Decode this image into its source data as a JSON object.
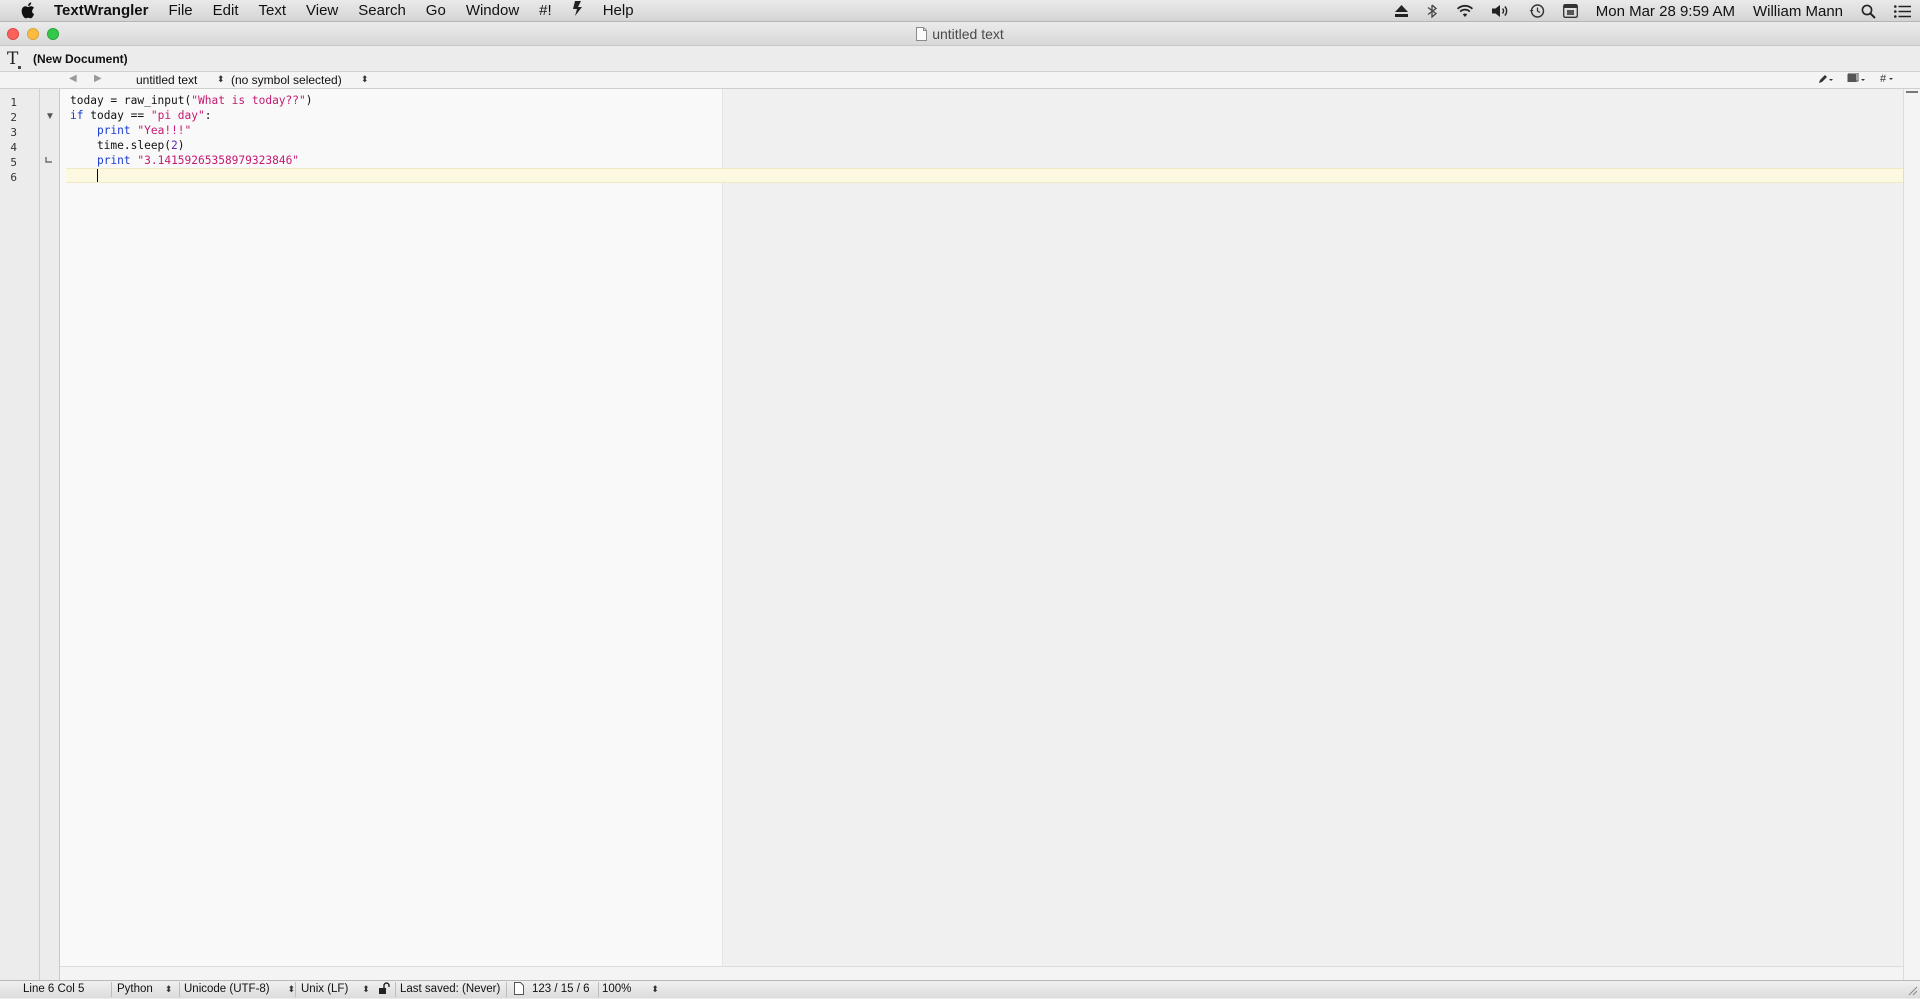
{
  "menubar": {
    "app_name": "TextWrangler",
    "menus": [
      "File",
      "Edit",
      "Text",
      "View",
      "Search",
      "Go",
      "Window",
      "#!",
      "Help"
    ],
    "clock": "Mon Mar 28  9:59 AM",
    "user": "William Mann",
    "status_icons": [
      "eject-icon",
      "bluetooth-icon",
      "wifi-icon",
      "volume-icon",
      "time-machine-icon",
      "calendar-icon",
      "spotlight-icon",
      "notification-center-icon"
    ]
  },
  "window": {
    "title": "untitled text"
  },
  "docbar": {
    "doc_name": "(New Document)"
  },
  "navbar": {
    "file_selector": "untitled text",
    "symbol_selector": "(no symbol selected)"
  },
  "editor": {
    "line_numbers": [
      "1",
      "2",
      "3",
      "4",
      "5",
      "6"
    ],
    "lines": [
      [
        {
          "t": "today = raw_input(",
          "c": "plain"
        },
        {
          "t": "\"What is today??\"",
          "c": "str"
        },
        {
          "t": ")",
          "c": "plain"
        }
      ],
      [
        {
          "t": "if",
          "c": "kw"
        },
        {
          "t": " today == ",
          "c": "plain"
        },
        {
          "t": "\"pi day\"",
          "c": "str"
        },
        {
          "t": ":",
          "c": "plain"
        }
      ],
      [
        {
          "t": "    ",
          "c": "plain"
        },
        {
          "t": "print",
          "c": "kw"
        },
        {
          "t": " ",
          "c": "plain"
        },
        {
          "t": "\"Yea!!!\"",
          "c": "str"
        }
      ],
      [
        {
          "t": "    time.sleep(",
          "c": "plain"
        },
        {
          "t": "2",
          "c": "num"
        },
        {
          "t": ")",
          "c": "plain"
        }
      ],
      [
        {
          "t": "    ",
          "c": "plain"
        },
        {
          "t": "print",
          "c": "kw"
        },
        {
          "t": " ",
          "c": "plain"
        },
        {
          "t": "\"3.14159265358979323846\"",
          "c": "str"
        }
      ],
      [
        {
          "t": "    ",
          "c": "plain"
        }
      ]
    ]
  },
  "statusbar": {
    "position": "Line 6 Col 5",
    "language": "Python",
    "encoding": "Unicode (UTF-8)",
    "line_endings": "Unix (LF)",
    "last_saved": "Last saved: (Never)",
    "counts": "123 / 15 / 6",
    "zoom": "100%"
  },
  "colors": {
    "keyword": "#1a3cd0",
    "string": "#c41a73",
    "number": "#6a2ab8",
    "current_line": "#fdf8e0"
  }
}
